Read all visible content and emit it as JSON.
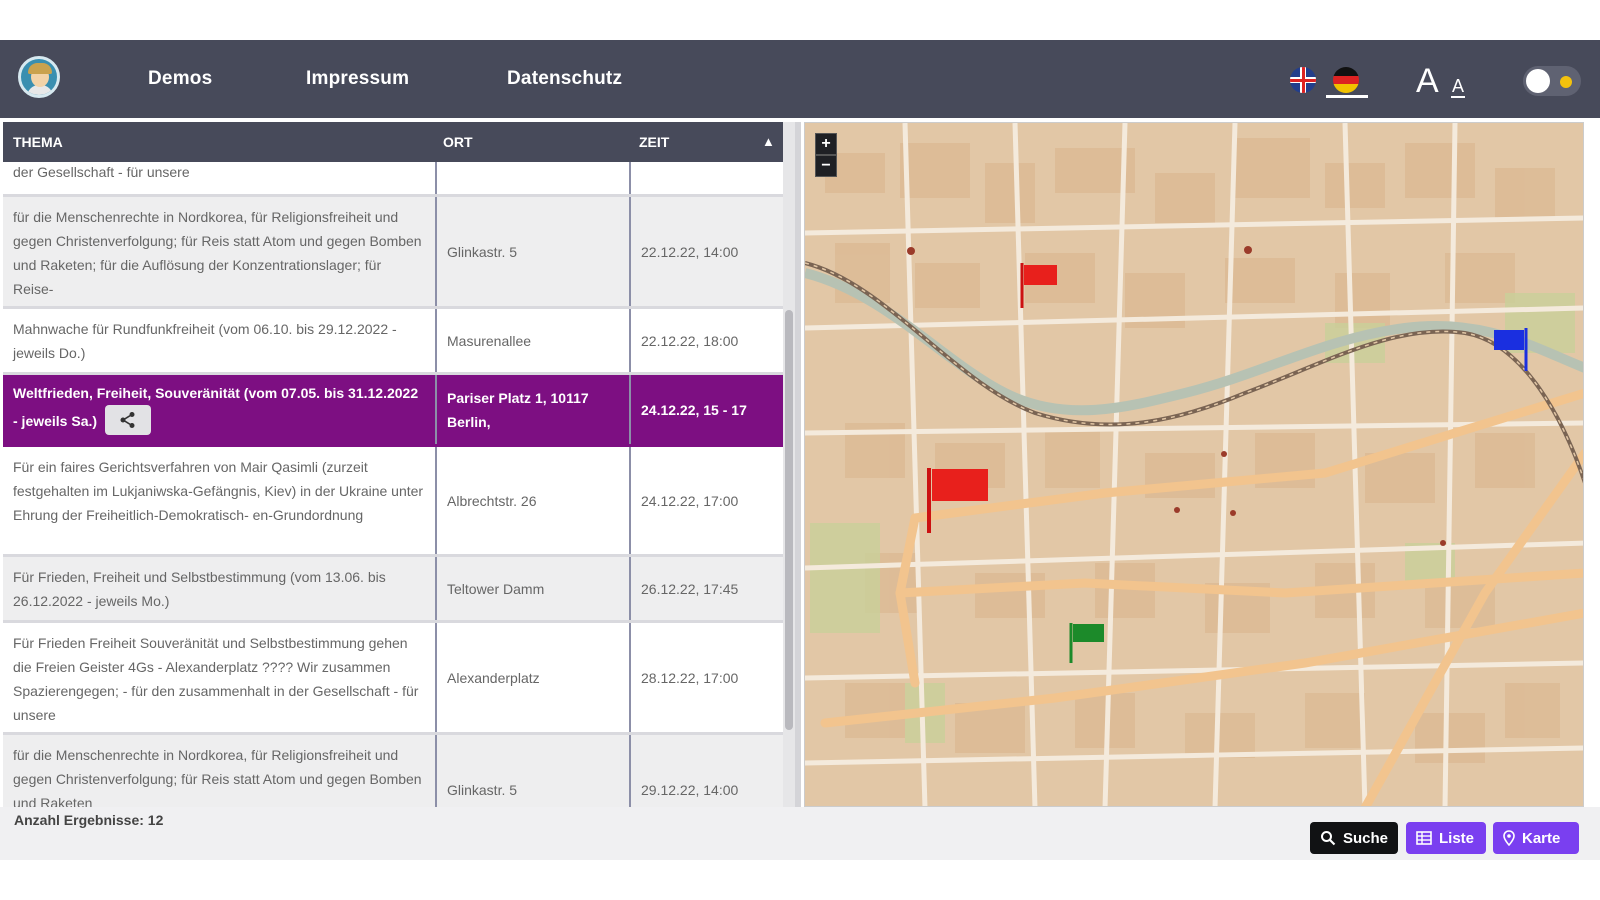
{
  "header": {
    "nav": [
      "Demos",
      "Impressum",
      "Datenschutz"
    ],
    "font_large_label": "A",
    "font_small_label": "A"
  },
  "table": {
    "columns": [
      "THEMA",
      "ORT",
      "ZEIT"
    ],
    "rows": [
      {
        "thema": "der Gesellschaft - für unsere",
        "ort": "",
        "zeit": ""
      },
      {
        "thema": "für die Menschenrechte in Nordkorea, für Religionsfreiheit und gegen Christenverfolgung; für Reis statt Atom und gegen Bomben und Raketen; für die Auflösung der Konzentrationslager; für Reise-",
        "ort": "Glinkastr. 5",
        "zeit": "22.12.22, 14:00"
      },
      {
        "thema": "Mahnwache für Rundfunkfreiheit (vom 06.10. bis 29.12.2022 - jeweils Do.)",
        "ort": "Masurenallee",
        "zeit": "22.12.22, 18:00"
      },
      {
        "thema": "Weltfrieden, Freiheit, Souveränität (vom 07.05. bis 31.12.2022 - jeweils Sa.)",
        "ort": "Pariser Platz 1, 10117 Berlin,",
        "zeit": "24.12.22, 15 - 17",
        "selected": true
      },
      {
        "thema": "Für ein faires Gerichtsverfahren von Mair Qasimli (zurzeit festgehalten im Lukjaniwska-Gefängnis, Kiev) in der Ukraine unter Ehrung der Freiheitlich-Demokratisch- en-Grundordnung",
        "ort": "Albrechtstr. 26",
        "zeit": "24.12.22, 17:00"
      },
      {
        "thema": "Für Frieden, Freiheit und Selbstbestimmung (vom 13.06. bis 26.12.2022 - jeweils Mo.)",
        "ort": "Teltower Damm",
        "zeit": "26.12.22, 17:45"
      },
      {
        "thema": "Für Frieden Freiheit Souveränität und Selbstbestimmung gehen die Freien Geister 4Gs - Alexanderplatz ???? Wir zusammen Spazierengegen; - für den zusammenhalt in der Gesellschaft - für unsere",
        "ort": "Alexanderplatz",
        "zeit": "28.12.22, 17:00"
      },
      {
        "thema": "für die Menschenrechte in Nordkorea, für Religionsfreiheit und gegen Christenverfolgung; für Reis statt Atom und gegen Bomben und Raketen",
        "ort": "Glinkastr. 5",
        "zeit": "29.12.22, 14:00"
      }
    ],
    "result_count": "Anzahl Ergebnisse: 12"
  },
  "map": {
    "zoom_in": "+",
    "zoom_out": "−",
    "flags": [
      {
        "color": "#e8201c"
      },
      {
        "color": "#e8201c"
      },
      {
        "color": "#1a2fe0"
      },
      {
        "color": "#1c8a2a"
      }
    ]
  },
  "buttons": {
    "suche": "Suche",
    "liste": "Liste",
    "karte": "Karte"
  },
  "colors": {
    "header": "#474a5a",
    "selected_row": "#7d0f82",
    "accent": "#7a3ff0"
  }
}
